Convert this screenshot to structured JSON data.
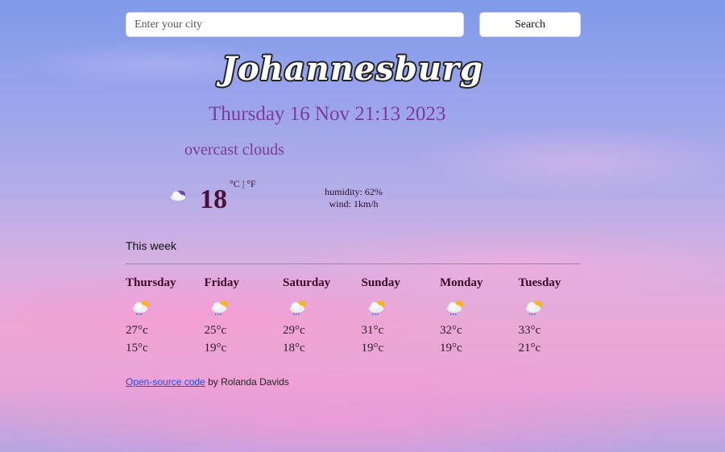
{
  "search": {
    "placeholder": "Enter your city",
    "value": "",
    "button_label": "Search"
  },
  "current": {
    "city": "Johannesburg",
    "datetime": "Thursday 16 Nov 21:13 2023",
    "description": "overcast clouds",
    "icon": "overcast-clouds-icon",
    "temperature": "18",
    "unit_celsius": "°C",
    "unit_separator": " | ",
    "unit_fahrenheit": "°F",
    "humidity": "humidity: 62%",
    "wind": "wind: 1km/h"
  },
  "forecast": {
    "title": "This week",
    "days": [
      {
        "name": "Thursday",
        "icon": "rain-sun-cloud-icon",
        "max": "27°c",
        "min": "15°c"
      },
      {
        "name": "Friday",
        "icon": "rain-sun-cloud-icon",
        "max": "25°c",
        "min": "19°c"
      },
      {
        "name": "Saturday",
        "icon": "rain-sun-cloud-icon",
        "max": "29°c",
        "min": "18°c"
      },
      {
        "name": "Sunday",
        "icon": "rain-sun-cloud-icon",
        "max": "31°c",
        "min": "19°c"
      },
      {
        "name": "Monday",
        "icon": "rain-sun-cloud-icon",
        "max": "32°c",
        "min": "19°c"
      },
      {
        "name": "Tuesday",
        "icon": "rain-sun-cloud-icon",
        "max": "33°c",
        "min": "21°c"
      }
    ]
  },
  "footer": {
    "link_text": "Open-source code",
    "suffix": " by Rolanda Davids"
  },
  "colors": {
    "accent_purple": "#7d3a9a",
    "temp_dark": "#4a1038",
    "link_blue": "#2a4ae0"
  }
}
